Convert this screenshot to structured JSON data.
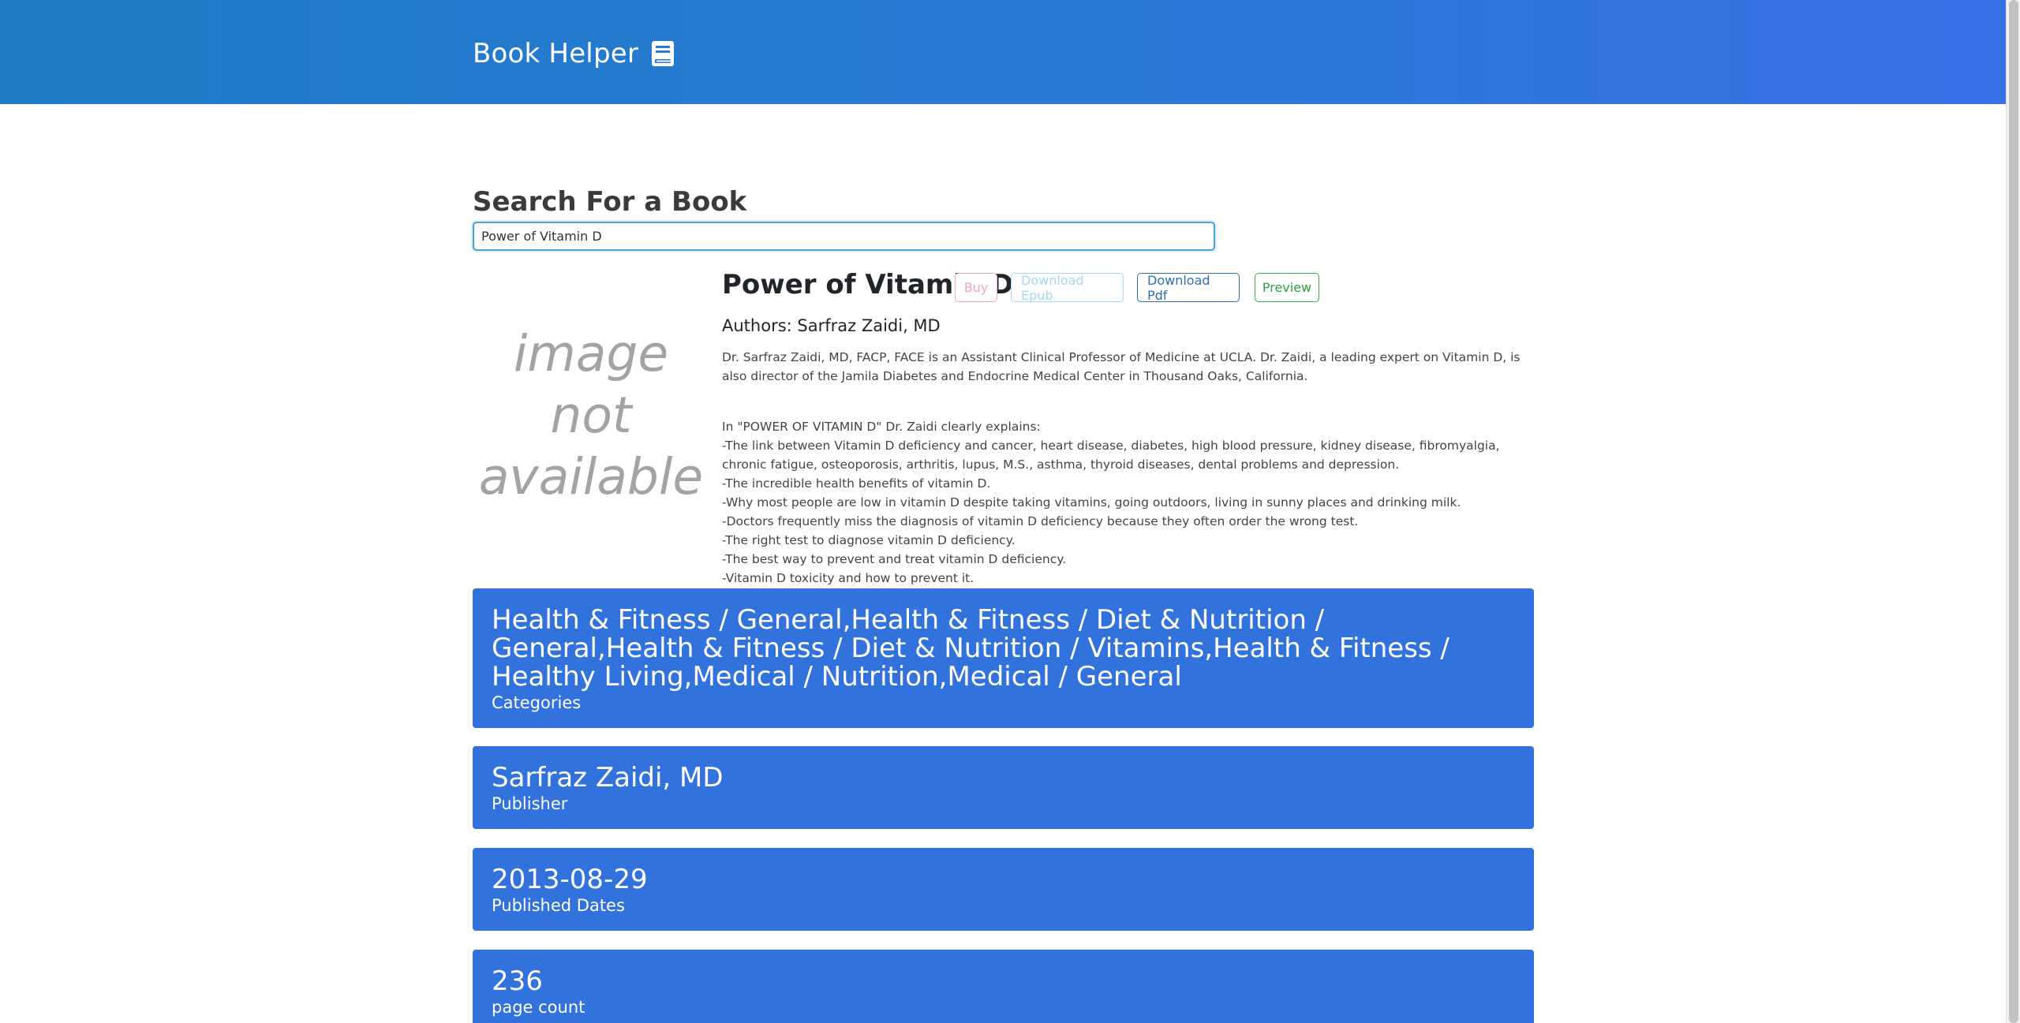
{
  "header": {
    "title": "Book Helper",
    "icon": "book-icon"
  },
  "search": {
    "heading": "Search For a Book",
    "value": "Power of Vitamin D"
  },
  "book": {
    "cover_placeholder": "image not available",
    "title": "Power of Vitamin D",
    "actions": {
      "buy": "Buy",
      "download_epub": "Download Epub",
      "download_pdf": "Download Pdf",
      "preview": "Preview"
    },
    "authors": "Authors: Sarfraz Zaidi, MD",
    "description": {
      "intro": "Dr. Sarfraz Zaidi, MD, FACP, FACE is an Assistant Clinical Professor of Medicine at UCLA. Dr. Zaidi, a leading expert on Vitamin D, is also director of the Jamila Diabetes and Endocrine Medical Center in Thousand Oaks, California.",
      "lines": [
        "In \"POWER OF VITAMIN D\" Dr. Zaidi clearly explains:",
        "-The link between Vitamin D deficiency and cancer, heart disease, diabetes, high blood pressure, kidney disease, fibromyalgia, chronic fatigue, osteoporosis, arthritis, lupus, M.S., asthma, thyroid diseases, dental problems and depression.",
        "-The incredible health benefits of vitamin D.",
        "-Why most people are low in vitamin D despite taking vitamins, going outdoors, living in sunny places and drinking milk.",
        "-Doctors frequently miss the diagnosis of vitamin D deficiency because they often order the wrong test.",
        "-The right test to diagnose vitamin D deficiency.",
        "-The best way to prevent and treat vitamin D deficiency.",
        "-Vitamin D toxicity and how to prevent it."
      ]
    }
  },
  "cards": {
    "categories": {
      "value": "Health & Fitness / General,Health & Fitness / Diet & Nutrition / General,Health & Fitness / Diet & Nutrition / Vitamins,Health & Fitness / Healthy Living,Medical / Nutrition,Medical / General",
      "label": "Categories"
    },
    "publisher": {
      "value": "Sarfraz Zaidi, MD",
      "label": "Publisher"
    },
    "published_date": {
      "value": "2013-08-29",
      "label": "Published Dates"
    },
    "page_count": {
      "value": "236",
      "label": "page count"
    }
  },
  "colors": {
    "header_start": "#1e7bc4",
    "header_end": "#3a70e6",
    "card_bg": "#3272dc",
    "buy": "#f3a6b8",
    "epub": "#a8d6f2",
    "pdf": "#2c6fb0",
    "preview": "#31b14a"
  }
}
